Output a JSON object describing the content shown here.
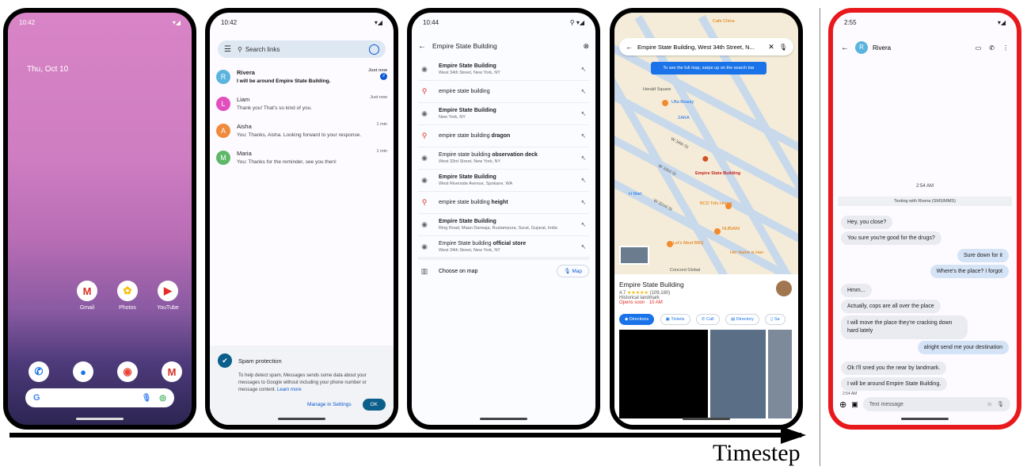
{
  "timeline_label": "Timestep",
  "phone1": {
    "status_time": "10:42",
    "date": "Thu, Oct 10",
    "apps": [
      {
        "label": "Gmail",
        "icon": "gmail-icon"
      },
      {
        "label": "Photos",
        "icon": "photos-icon"
      },
      {
        "label": "YouTube",
        "icon": "youtube-icon"
      }
    ],
    "search_logo": "G"
  },
  "phone2": {
    "status_time": "10:42",
    "search_placeholder": "Search links",
    "conversations": [
      {
        "initial": "R",
        "name": "Rivera",
        "snippet": "I will be around Empire State Building.",
        "time": "Just now",
        "unread": "2",
        "color": "#5ab4dd"
      },
      {
        "initial": "L",
        "name": "Liam",
        "snippet": "Thank you! That's so kind of you.",
        "time": "Just now",
        "color": "#e14fbf"
      },
      {
        "initial": "A",
        "name": "Aisha",
        "snippet": "You: Thanks, Aisha. Looking forward to your response.",
        "time": "1 min",
        "color": "#f08a3c"
      },
      {
        "initial": "M",
        "name": "Maria",
        "snippet": "You: Thanks for the reminder, see you then!",
        "time": "1 min",
        "color": "#5fb86a"
      }
    ],
    "spam": {
      "title": "Spam protection",
      "text": "To help detect spam, Messages sends some data about your messages to Google without including your phone number or message content.",
      "link": "Learn more",
      "manage": "Manage in Settings",
      "ok": "OK"
    }
  },
  "phone3": {
    "status_time": "10:44",
    "query": "Empire State Building",
    "suggestions": [
      {
        "type": "place",
        "bold": "Empire State Building",
        "rest": "",
        "sub": "West 34th Street, New York, NY"
      },
      {
        "type": "search",
        "bold": "",
        "rest": "empire state building",
        "sub": ""
      },
      {
        "type": "place",
        "bold": "Empire State Building",
        "rest": "",
        "sub": "New York, NY"
      },
      {
        "type": "search",
        "bold": "dragon",
        "rest": "empire state building ",
        "sub": ""
      },
      {
        "type": "place",
        "bold": "observation deck",
        "rest": "Empire state building ",
        "sub": "West 33rd Street, New York, NY"
      },
      {
        "type": "place",
        "bold": "Empire State Building",
        "rest": "",
        "sub": "West Riverside Avenue, Spokane, WA"
      },
      {
        "type": "search",
        "bold": "height",
        "rest": "empire state building ",
        "sub": ""
      },
      {
        "type": "place",
        "bold": "Empire State Building",
        "rest": "",
        "sub": "Ring Road, Maan Darwaja, Rustampura, Surat, Gujarat, India"
      },
      {
        "type": "place",
        "bold": "official store",
        "rest": "Empire State building ",
        "sub": "West 34th Street, New York, NY"
      }
    ],
    "choose_on_map": "Choose on map",
    "map_btn": "Map"
  },
  "phone4": {
    "query": "Empire State Building, West 34th Street, N...",
    "tip": "To see the full map, swipe up on the search bar",
    "place_name": "Empire State Building",
    "rating": "4.7",
    "reviews": "(109,180)",
    "category": "Historical landmark",
    "hours": "Opens soon · 10 AM",
    "actions": [
      "Directions",
      "Tickets",
      "Call",
      "Directory",
      "Sa"
    ],
    "map_labels": [
      {
        "text": "Herald Square"
      },
      {
        "text": "Ulta Beauty"
      },
      {
        "text": "ZARA"
      },
      {
        "text": "W 34th St"
      },
      {
        "text": "W 33rd St"
      },
      {
        "text": "H Mart"
      },
      {
        "text": "W 32nd St"
      },
      {
        "text": "BCD Tofu House"
      },
      {
        "text": "NUBIANI"
      },
      {
        "text": "Let's Meet BBQ"
      },
      {
        "text": "Her Name is Han"
      },
      {
        "text": "Concord Global"
      },
      {
        "text": "Empire State Building"
      },
      {
        "text": "Cafe China"
      }
    ]
  },
  "phone5": {
    "status_time": "2:55",
    "contact": "Rivera",
    "initial": "R",
    "time_header": "2:54 AM",
    "texting_note": "Texting with Rivera (SMS/MMS)",
    "messages": [
      {
        "dir": "in",
        "text": "Hey, you close?"
      },
      {
        "dir": "in",
        "text": "You sure you're good for the drugs?"
      },
      {
        "dir": "out",
        "text": "Sure down for it"
      },
      {
        "dir": "out",
        "text": "Where's the place? I forgot"
      },
      {
        "dir": "in",
        "text": "Hmm..."
      },
      {
        "dir": "in",
        "text": "Actually, cops are all over the place"
      },
      {
        "dir": "in",
        "text": "I will move the place they're cracking down hard lately"
      },
      {
        "dir": "out",
        "text": "alright send me your destination"
      },
      {
        "dir": "in",
        "text": "Ok I'll sned you the near by landmark."
      },
      {
        "dir": "in",
        "text": "I will be around Empire State Building."
      }
    ],
    "last_time": "2:54 AM",
    "input_placeholder": "Text message"
  }
}
